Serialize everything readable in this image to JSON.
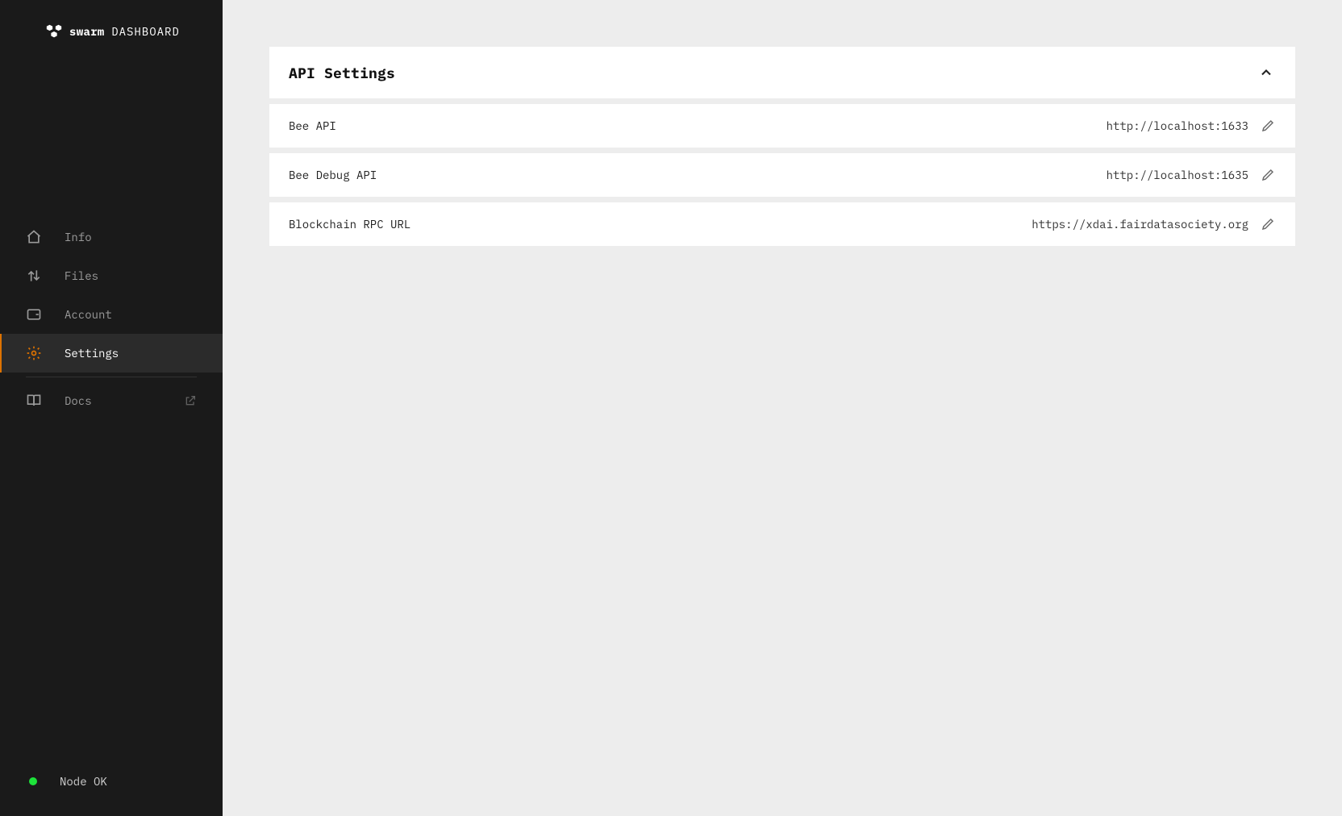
{
  "logo": {
    "brand": "swarm",
    "sub": "DASHBOARD"
  },
  "sidebar": {
    "items": [
      {
        "label": "Info"
      },
      {
        "label": "Files"
      },
      {
        "label": "Account"
      },
      {
        "label": "Settings"
      },
      {
        "label": "Docs"
      }
    ]
  },
  "status": {
    "label": "Node OK",
    "color": "#1de33a"
  },
  "settings": {
    "section_title": "API Settings",
    "items": [
      {
        "label": "Bee API",
        "value": "http://localhost:1633"
      },
      {
        "label": "Bee Debug API",
        "value": "http://localhost:1635"
      },
      {
        "label": "Blockchain RPC URL",
        "value": "https://xdai.fairdatasociety.org"
      }
    ]
  },
  "colors": {
    "accent": "#dd7200",
    "sidebar_bg": "#1a1a1a",
    "body_bg": "#ededed",
    "status_ok": "#1de33a"
  }
}
